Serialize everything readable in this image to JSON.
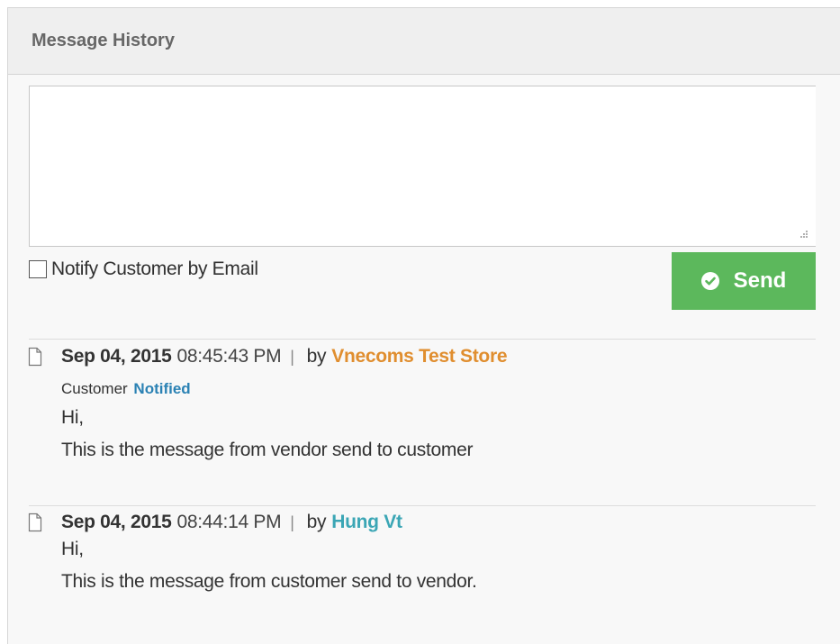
{
  "panel": {
    "title": "Message History"
  },
  "form": {
    "comment_value": "",
    "notify_label": "Notify Customer by Email",
    "notify_checked": false,
    "send_label": "Send"
  },
  "history": [
    {
      "date": "Sep 04, 2015",
      "time": "08:45:43 PM",
      "separator": "|",
      "by": "by",
      "author": "Vnecoms Test Store",
      "status_prefix": "Customer",
      "status_value": "Notified",
      "lines": [
        "Hi,",
        "This is the message from vendor send to customer"
      ]
    },
    {
      "date": "Sep 04, 2015",
      "time": "08:44:14 PM",
      "separator": "|",
      "by": "by",
      "author": "Hung Vt",
      "lines": [
        "Hi,",
        "This is the message from customer send to vendor."
      ]
    }
  ],
  "colors": {
    "send_button": "#5cb85c",
    "vendor_author": "#e08e2f",
    "customer_author": "#3ba6b5",
    "status_notified": "#2b82b4"
  },
  "icons": {
    "send": "check-circle-icon",
    "entry": "document-icon"
  }
}
